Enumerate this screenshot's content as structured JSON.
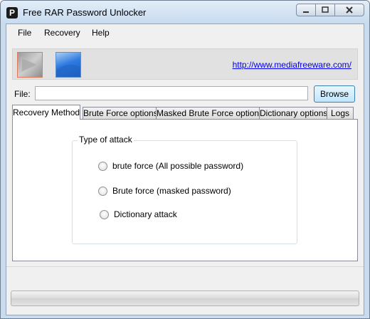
{
  "window": {
    "title": "Free RAR Password Unlocker",
    "app_icon_glyph": "P"
  },
  "menu": {
    "items": [
      {
        "label": "File"
      },
      {
        "label": "Recovery"
      },
      {
        "label": "Help"
      }
    ]
  },
  "toolbar": {
    "link_text": "http://www.mediafreeware.com/",
    "start_icon": "play-icon",
    "secondary_icon": "blue-panel-icon"
  },
  "file": {
    "label": "File:",
    "value": "",
    "browse_label": "Browse"
  },
  "tabs": [
    {
      "label": "Recovery Method",
      "active": true
    },
    {
      "label": "Brute Force options",
      "active": false
    },
    {
      "label": "Masked Brute Force options",
      "active": false
    },
    {
      "label": "Dictionary options",
      "active": false
    },
    {
      "label": "Logs",
      "active": false
    }
  ],
  "attack": {
    "group_title": "Type of attack",
    "options": [
      {
        "label": "brute force (All possible password)",
        "selected": false
      },
      {
        "label": "Brute force (masked password)",
        "selected": false
      },
      {
        "label": "Dictionary attack",
        "selected": false
      }
    ]
  },
  "progress": {
    "percent": 0
  },
  "colors": {
    "window_frame": "#c9dcef",
    "client_bg": "#f0f0f0",
    "link": "#0000ee",
    "browse_border": "#3c7fb1"
  }
}
